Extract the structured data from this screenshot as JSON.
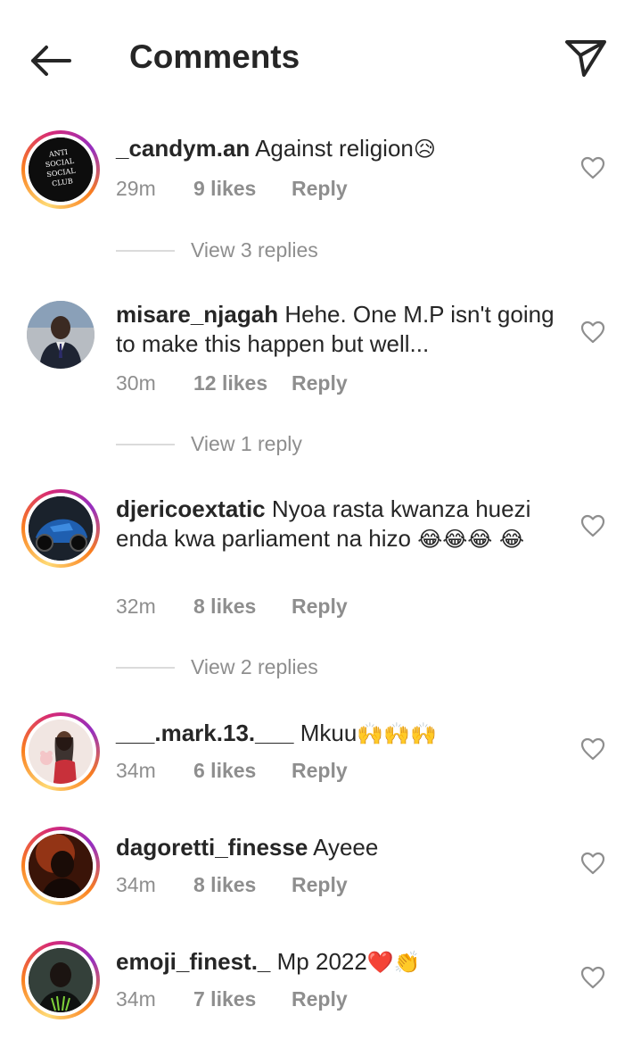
{
  "header": {
    "title": "Comments",
    "back_icon": "arrow-left-icon",
    "share_icon": "paper-plane-icon"
  },
  "comments": [
    {
      "username": "_candym.an",
      "text": "Against religion",
      "emoji": "😥",
      "time": "29m",
      "likes": "9 likes",
      "reply": "Reply",
      "view_replies": "View 3 replies",
      "avatar_text": [
        "ANTI",
        "SOCIAL",
        "SOCIAL",
        "CLUB"
      ]
    },
    {
      "username": "misare_njagah",
      "text": "Hehe. One M.P isn't going to make this happen but well...",
      "time": "30m",
      "likes": "12 likes",
      "reply": "Reply",
      "view_replies": "View 1 reply"
    },
    {
      "username": "djericoextatic",
      "text": "Nyoa rasta kwanza huezi enda kwa parliament na hizo",
      "emoji": "😂😂😂 😂",
      "time": "32m",
      "likes": "8 likes",
      "reply": "Reply",
      "view_replies": "View 2 replies"
    },
    {
      "username": "___.mark.13.___",
      "text": "Mkuu",
      "emoji": "🙌🙌🙌",
      "time": "34m",
      "likes": "6 likes",
      "reply": "Reply"
    },
    {
      "username": "dagoretti_finesse",
      "text": "Ayeee",
      "time": "34m",
      "likes": "8 likes",
      "reply": "Reply"
    },
    {
      "username": "emoji_finest._",
      "text": "Mp 2022",
      "emoji": "❤️👏",
      "time": "34m",
      "likes": "7 likes",
      "reply": "Reply"
    }
  ],
  "colors": {
    "text": "#262626",
    "secondary": "#8e8e8e",
    "divider": "#dbdbdb"
  }
}
